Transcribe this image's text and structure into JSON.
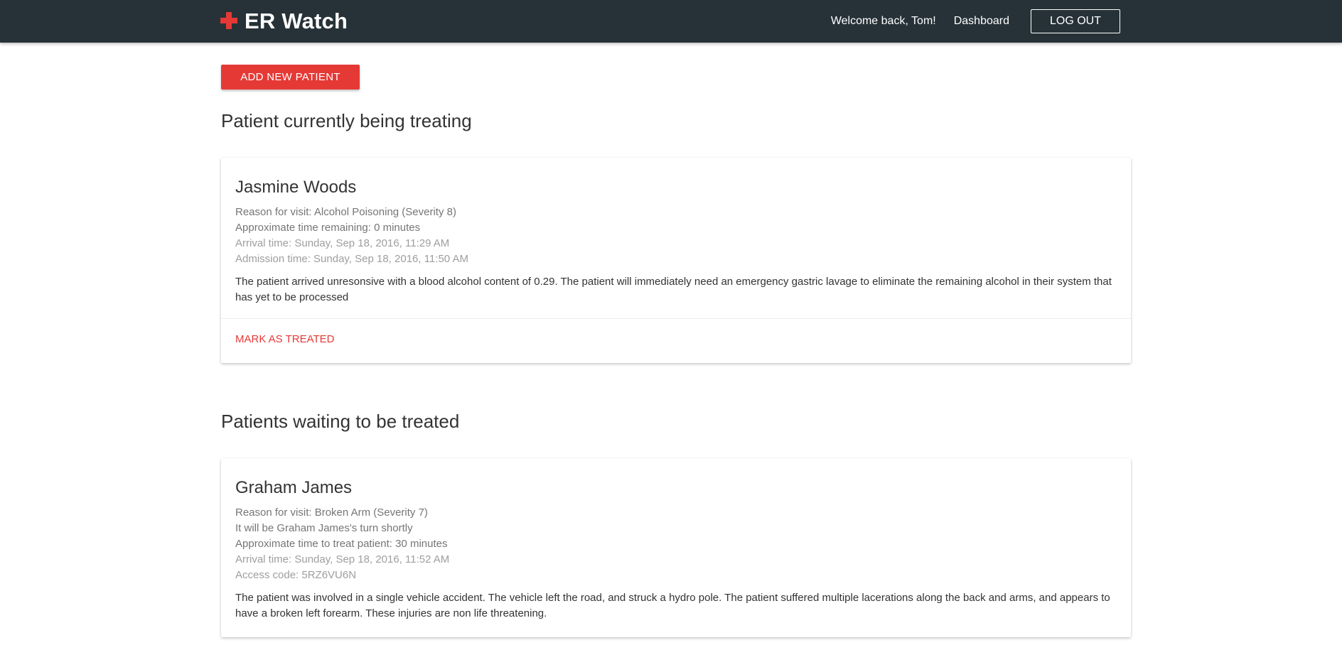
{
  "navbar": {
    "brand": "ER Watch",
    "welcome": "Welcome back, Tom!",
    "dashboard_link": "Dashboard",
    "logout_label": "LOG OUT",
    "cross_icon": "red-cross-icon",
    "accent_color": "#e53935",
    "bg_color": "#263238"
  },
  "actions": {
    "add_patient_label": "ADD NEW PATIENT"
  },
  "current_section": {
    "heading": "Patient currently being treating",
    "patient": {
      "name": "Jasmine Woods",
      "reason": "Reason for visit: Alcohol Poisoning (Severity 8)",
      "time_remaining": "Approximate time remaining: 0 minutes",
      "arrival": "Arrival time: Sunday, Sep 18, 2016, 11:29 AM",
      "admission": "Admission time: Sunday, Sep 18, 2016, 11:50 AM",
      "description": "The patient arrived unresonsive with a blood alcohol content of 0.29. The patient will immediately need an emergency gastric lavage to eliminate the remaining alcohol in their system that has yet to be processed",
      "action_label": "MARK AS TREATED"
    }
  },
  "waiting_section": {
    "heading": "Patients waiting to be treated",
    "patients": [
      {
        "name": "Graham James",
        "reason": "Reason for visit: Broken Arm (Severity 7)",
        "turn": "It will be Graham James's turn shortly",
        "time_to_treat": "Approximate time to treat patient: 30 minutes",
        "arrival": "Arrival time: Sunday, Sep 18, 2016, 11:52 AM",
        "access_code": "Access code: 5RZ6VU6N",
        "description": "The patient was involved in a single vehicle accident. The vehicle left the road, and struck a hydro pole. The patient suffered multiple lacerations along the back and arms, and appears to have a broken left forearm. These injuries are non life threatening."
      }
    ]
  }
}
